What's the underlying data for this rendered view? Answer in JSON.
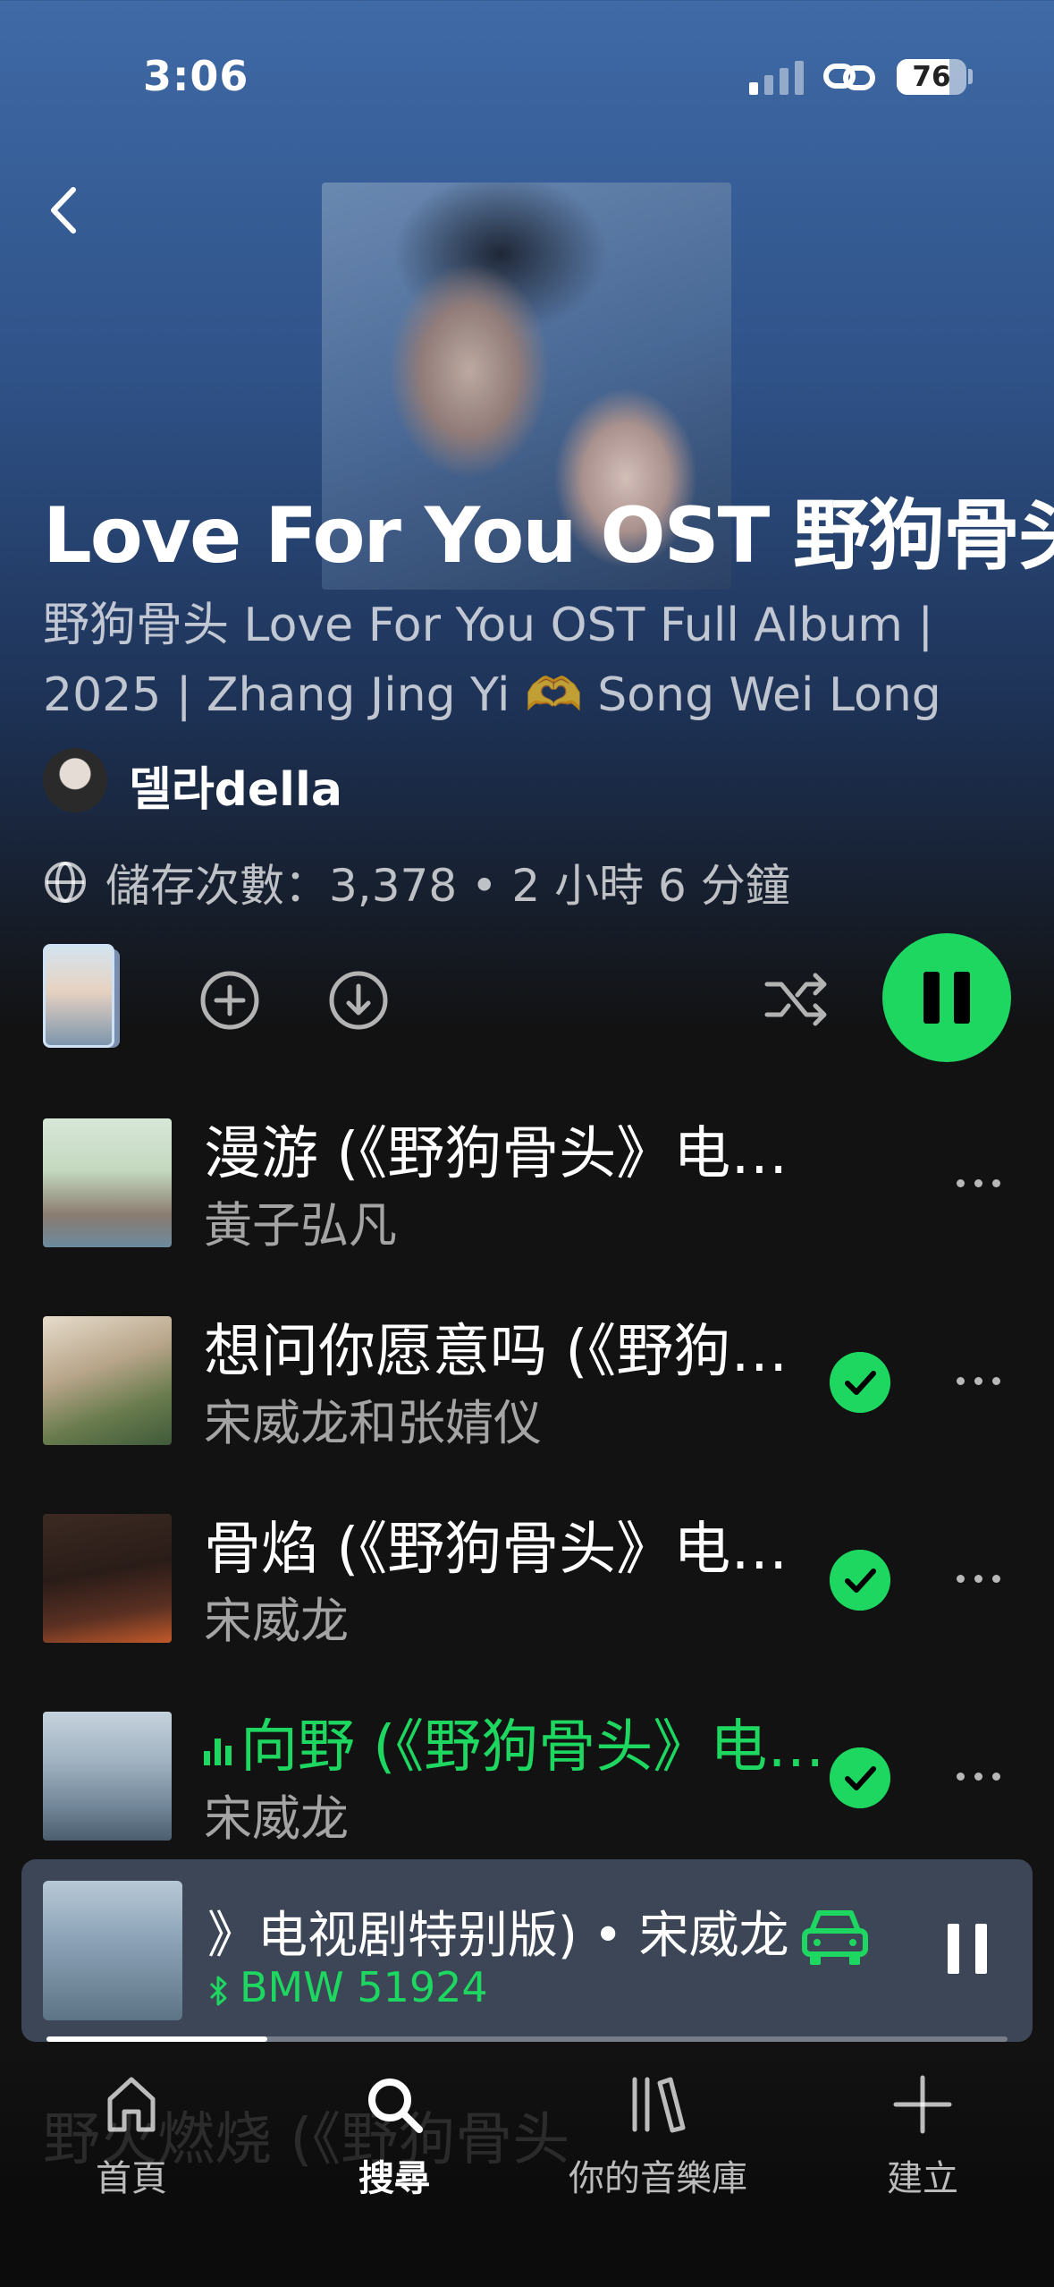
{
  "status_bar": {
    "time": "3:06",
    "battery": "76"
  },
  "playlist": {
    "title": "Love For You OST 野狗骨头",
    "description_line1": "野狗骨头 Love For You OST Full Album |",
    "description_line2": "2025 | Zhang Jing Yi 🫶 Song Wei Long",
    "owner": "델라della",
    "meta": "儲存次數：3,378 • 2 小時 6 分鐘"
  },
  "icons": {
    "back": "chevron-left-icon",
    "add": "plus-circle-icon",
    "download": "download-icon",
    "shuffle": "shuffle-icon",
    "play": "pause-icon",
    "more": "more-dots-icon",
    "downloaded": "check-circle-icon",
    "car": "car-icon",
    "bluetooth": "bluetooth-icon"
  },
  "colors": {
    "accent": "#1ed760",
    "background": "#121212",
    "header": "#3f6aa6"
  },
  "tracks": [
    {
      "title": "漫游 (《野狗骨头》电视剧特别版)",
      "artist": "黃子弘凡",
      "downloaded": false,
      "playing": false
    },
    {
      "title": "想问你愿意吗 (《野狗骨头》电视剧特别版)",
      "artist": "宋威龙和张婧仪",
      "downloaded": true,
      "playing": false
    },
    {
      "title": "骨焰 (《野狗骨头》电视剧特别版)",
      "artist": "宋威龙",
      "downloaded": true,
      "playing": false
    },
    {
      "title": "向野 (《野狗骨头》电视剧特别版)",
      "artist": "宋威龙",
      "downloaded": true,
      "playing": true
    }
  ],
  "now_playing": {
    "title": "》电视剧特别版) • 宋威龙",
    "device": "BMW 51924",
    "progress": 0.23
  },
  "ghost_row": "野火燃烧 (《野狗骨头",
  "nav": [
    {
      "label": "首頁",
      "icon": "home-icon"
    },
    {
      "label": "搜尋",
      "icon": "search-icon"
    },
    {
      "label": "你的音樂庫",
      "icon": "library-icon"
    },
    {
      "label": "建立",
      "icon": "plus-icon"
    }
  ]
}
